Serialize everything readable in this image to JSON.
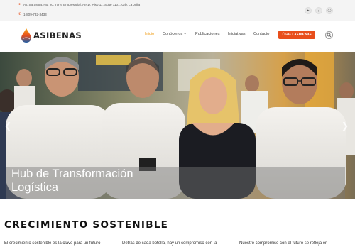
{
  "topbar": {
    "address": "Av. Sarasota, No. 20, Torre Empresarial, AIRD, Piso 11, Suite 1101, Urb. La Julia",
    "phone": "1-809-732-3433",
    "social": [
      "youtube-icon",
      "twitter-icon",
      "instagram-icon"
    ]
  },
  "brand": {
    "name": "ASIBENAS",
    "accent": "#e84e1b"
  },
  "nav": {
    "items": [
      {
        "label": "Inicio",
        "active": true
      },
      {
        "label": "Conócenos"
      },
      {
        "label": "Publicaciones"
      },
      {
        "label": "Iniciativas"
      },
      {
        "label": "Contacto"
      }
    ],
    "cta_label": "Únete a ASIBENAS"
  },
  "hero": {
    "title": "Hub de Transformación Logística"
  },
  "section": {
    "title": "CRECIMIENTO SOSTENIBLE",
    "columns": [
      "El crecimiento sostenible es la clave para un futuro",
      "Detrás de cada botella, hay un compromiso con la",
      "Nuestro compromiso con el futuro se refleja en"
    ]
  }
}
